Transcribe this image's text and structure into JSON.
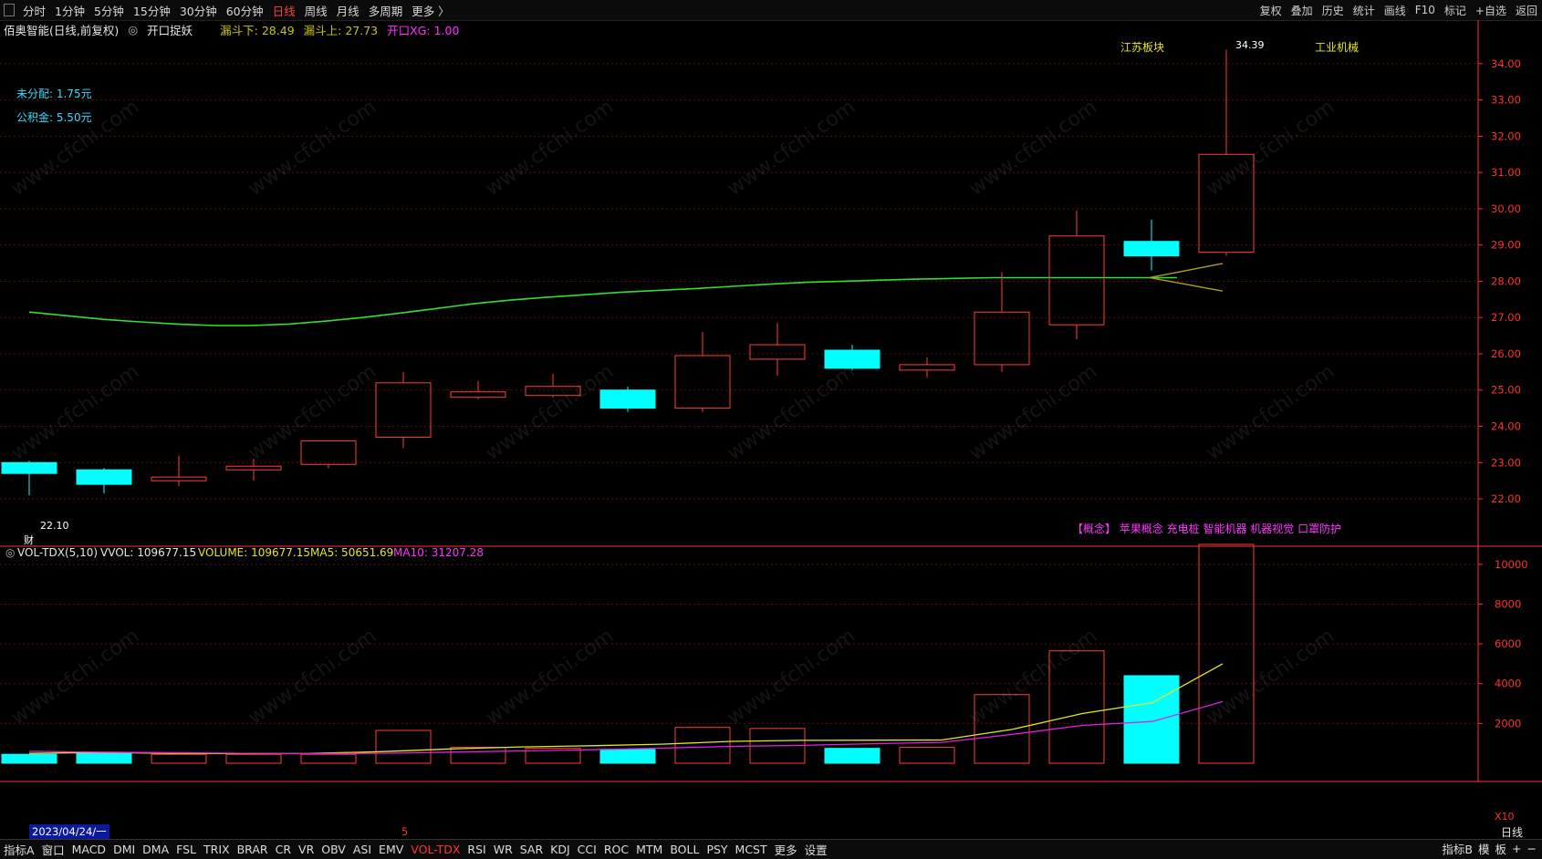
{
  "toolbar": {
    "periods": [
      "分时",
      "1分钟",
      "5分钟",
      "15分钟",
      "30分钟",
      "60分钟",
      "日线",
      "周线",
      "月线",
      "多周期",
      "更多 〉"
    ],
    "active_period": "日线",
    "right_buttons": [
      "复权",
      "叠加",
      "历史",
      "统计",
      "画线",
      "F10",
      "标记",
      "+自选",
      "返回"
    ]
  },
  "info": {
    "title": "佰奥智能(日线,前复权)",
    "indicator": "开口捉妖",
    "lower": "漏斗下: 28.49",
    "upper": "漏斗上: 27.73",
    "xg": "开口XG: 1.00"
  },
  "notes": {
    "undistributed": "未分配: 1.75元",
    "reserve": "公积金: 5.50元",
    "sector": "江苏板块",
    "industry": "工业机械",
    "concepts": "【概念】 苹果概念 充电桩 智能机器 机器视觉 口罩防护",
    "high_label": "34.39",
    "low_label": "22.10",
    "fin_mark": "财"
  },
  "volume_header": {
    "name": "VOL-TDX(5,10)",
    "vvol": "VVOL: 109677.15",
    "volume": "VOLUME: 109677.15",
    "ma5": "MA5: 50651.69",
    "ma10": "MA10: 31207.28"
  },
  "date_label": "2023/04/24/一",
  "cursor_mark": "5",
  "unit_label": "X10",
  "period_label": "日线",
  "bottom_tabs": [
    "指标A",
    "窗口",
    "MACD",
    "DMI",
    "DMA",
    "FSL",
    "TRIX",
    "BRAR",
    "CR",
    "VR",
    "OBV",
    "ASI",
    "EMV",
    "VOL-TDX",
    "RSI",
    "WR",
    "SAR",
    "KDJ",
    "CCI",
    "ROC",
    "MTM",
    "BOLL",
    "PSY",
    "MCST",
    "更多",
    "设置"
  ],
  "active_bottom": "VOL-TDX",
  "bottom_right": [
    "指标B",
    "模",
    "板",
    "+",
    "−"
  ],
  "watermark": "www.cfchi.com",
  "colors": {
    "up": "#ff3c3c",
    "down": "#00ffff",
    "ma_green": "#33dd33",
    "ma5": "#e6e620",
    "ma10": "#e020e0",
    "axis": "#ff3030"
  },
  "chart_data": [
    {
      "type": "candlestick",
      "y_ticks": [
        22.0,
        23.0,
        24.0,
        25.0,
        26.0,
        27.0,
        28.0,
        29.0,
        30.0,
        31.0,
        32.0,
        33.0,
        34.0
      ],
      "ylim": [
        21.8,
        34.7
      ],
      "candles": [
        {
          "o": 23.0,
          "c": 22.7,
          "h": 23.05,
          "l": 22.1
        },
        {
          "o": 22.8,
          "c": 22.4,
          "h": 22.85,
          "l": 22.15
        },
        {
          "o": 22.5,
          "c": 22.6,
          "h": 23.2,
          "l": 22.35
        },
        {
          "o": 22.8,
          "c": 22.9,
          "h": 23.1,
          "l": 22.5
        },
        {
          "o": 22.95,
          "c": 23.6,
          "h": 23.6,
          "l": 22.85
        },
        {
          "o": 23.7,
          "c": 25.2,
          "h": 25.5,
          "l": 23.4
        },
        {
          "o": 24.8,
          "c": 24.95,
          "h": 25.25,
          "l": 24.75
        },
        {
          "o": 24.85,
          "c": 25.1,
          "h": 25.45,
          "l": 24.8
        },
        {
          "o": 25.0,
          "c": 24.5,
          "h": 25.1,
          "l": 24.4
        },
        {
          "o": 24.5,
          "c": 25.95,
          "h": 26.6,
          "l": 24.4
        },
        {
          "o": 25.85,
          "c": 26.25,
          "h": 26.85,
          "l": 25.4
        },
        {
          "o": 26.1,
          "c": 25.6,
          "h": 26.25,
          "l": 25.55
        },
        {
          "o": 25.55,
          "c": 25.7,
          "h": 25.9,
          "l": 25.35
        },
        {
          "o": 25.7,
          "c": 27.15,
          "h": 28.25,
          "l": 25.5
        },
        {
          "o": 26.8,
          "c": 29.25,
          "h": 29.95,
          "l": 26.4
        },
        {
          "o": 29.1,
          "c": 28.7,
          "h": 29.7,
          "l": 28.3
        },
        {
          "o": 28.8,
          "c": 31.5,
          "h": 34.39,
          "l": 28.7
        }
      ],
      "ma_line": [
        27.15,
        27.05,
        26.95,
        26.88,
        26.82,
        26.78,
        26.78,
        26.82,
        26.9,
        27.0,
        27.12,
        27.25,
        27.38,
        27.48,
        27.56,
        27.63,
        27.7,
        27.75,
        27.8,
        27.86,
        27.92,
        27.97,
        28.0,
        28.03,
        28.06,
        28.08,
        28.1,
        28.1,
        28.1,
        28.1,
        28.1,
        28.1
      ],
      "funnel": {
        "upper_end": 28.49,
        "lower_end": 27.73,
        "start": 28.1
      }
    },
    {
      "type": "bar",
      "series": [
        {
          "name": "VOLUME",
          "values": [
            450,
            550,
            450,
            450,
            450,
            1650,
            800,
            750,
            700,
            1800,
            1750,
            750,
            800,
            3450,
            5650,
            4400,
            11000
          ]
        },
        {
          "name": "MA5",
          "values": [
            500,
            540,
            500,
            480,
            490,
            580,
            720,
            820,
            880,
            960,
            1100,
            1150,
            1160,
            1170,
            1700,
            2500,
            3050,
            5000
          ]
        },
        {
          "name": "MA10",
          "values": [
            600,
            560,
            530,
            500,
            480,
            500,
            560,
            620,
            680,
            760,
            850,
            900,
            980,
            1050,
            1450,
            1900,
            2100,
            3100
          ]
        }
      ],
      "y_ticks": [
        2000,
        4000,
        6000,
        8000,
        10000
      ],
      "ylim": [
        0,
        11000
      ],
      "unit": "X10"
    }
  ]
}
